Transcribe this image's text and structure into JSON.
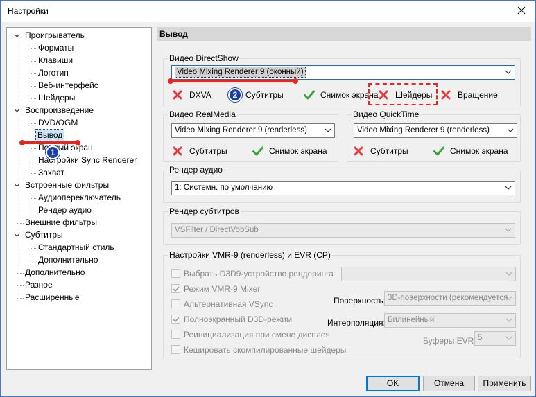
{
  "window": {
    "title": "Настройки"
  },
  "tree": {
    "items": [
      {
        "label": "Проигрыватель"
      },
      {
        "label": "Форматы"
      },
      {
        "label": "Клавиши"
      },
      {
        "label": "Логотип"
      },
      {
        "label": "Веб-интерфейс"
      },
      {
        "label": "Шейдеры"
      },
      {
        "label": "Воспроизведение"
      },
      {
        "label": "DVD/OGM"
      },
      {
        "label": "Вывод"
      },
      {
        "label": "Полный экран"
      },
      {
        "label": "Настройки Sync Renderer"
      },
      {
        "label": "Захват"
      },
      {
        "label": "Встроенные фильтры"
      },
      {
        "label": "Аудиопереключатель"
      },
      {
        "label": "Рендер аудио"
      },
      {
        "label": "Внешние фильтры"
      },
      {
        "label": "Субтитры"
      },
      {
        "label": "Стандартный стиль"
      },
      {
        "label": "Дополнительно"
      },
      {
        "label": "Дополнительно"
      },
      {
        "label": "Разное"
      },
      {
        "label": "Расширенные"
      }
    ],
    "selected_index": 8
  },
  "panel": {
    "header": "Вывод",
    "directshow": {
      "label": "Видео DirectShow",
      "value": "Video Mixing Renderer 9 (оконный)",
      "features": [
        {
          "label": "DXVA",
          "state": "no"
        },
        {
          "label": "Субтитры",
          "state": "no"
        },
        {
          "label": "Снимок экрана",
          "state": "yes"
        },
        {
          "label": "Шейдеры",
          "state": "no"
        },
        {
          "label": "Вращение",
          "state": "no"
        }
      ]
    },
    "realmedia": {
      "label": "Видео RealMedia",
      "value": "Video Mixing Renderer 9 (renderless)",
      "features": [
        {
          "label": "Субтитры",
          "state": "no"
        },
        {
          "label": "Снимок экрана",
          "state": "yes"
        }
      ]
    },
    "quicktime": {
      "label": "Видео QuickTime",
      "value": "Video Mixing Renderer 9 (renderless)",
      "features": [
        {
          "label": "Субтитры",
          "state": "no"
        },
        {
          "label": "Снимок экрана",
          "state": "yes"
        }
      ]
    },
    "audio": {
      "label": "Рендер аудио",
      "value": "1: Системн. по умолчанию"
    },
    "subtitles": {
      "label": "Рендер субтитров",
      "value": "VSFilter / DirectVobSub"
    },
    "vmr": {
      "label": "Настройки VMR-9 (renderless) и EVR (CP)",
      "checkboxes": [
        {
          "label": "Выбрать D3D9-устройство рендеринга",
          "checked": false
        },
        {
          "label": "Режим VMR-9 Mixer",
          "checked": true
        },
        {
          "label": "Альтернативная VSync",
          "checked": false
        },
        {
          "label": "Полноэкранный D3D-режим",
          "checked": true
        },
        {
          "label": "Реинициализация при смене дисплея",
          "checked": false
        },
        {
          "label": "Кешировать скомпилированные шейдеры",
          "checked": false
        }
      ],
      "surface_label": "Поверхность:",
      "surface_value": "3D-поверхности (рекомендуется",
      "interp_label": "Интерполяция:",
      "interp_value": "Билинейный",
      "buffers_label": "Буферы EVR:",
      "buffers_value": "5"
    }
  },
  "annotations": {
    "badge1": "1",
    "badge2": "2"
  },
  "buttons": {
    "ok": "OK",
    "cancel": "Отмена",
    "apply": "Применить"
  },
  "colors": {
    "accent": "#0078d7",
    "annotation_red": "#e8261e",
    "badge_blue": "#1a3fa8",
    "check_green": "#3aa53a",
    "cross_red": "#e0393e"
  }
}
